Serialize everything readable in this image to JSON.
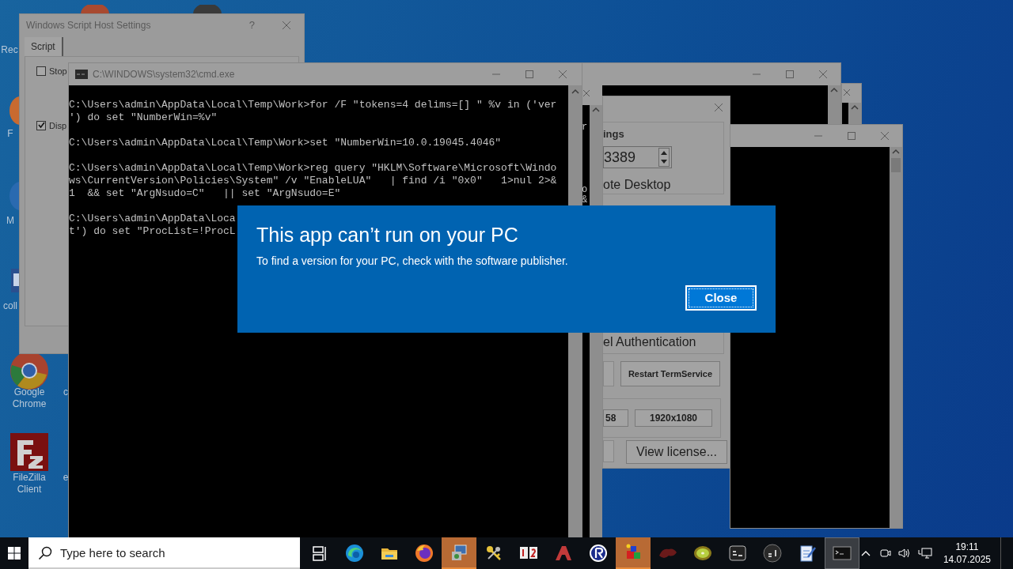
{
  "desktop_icons": [
    {
      "label": "Rec"
    },
    {
      "label": "F"
    },
    {
      "label": "M"
    },
    {
      "label": "coll"
    },
    {
      "label": "Google Chrome"
    },
    {
      "label": "FileZilla Client"
    },
    {
      "label": "c"
    },
    {
      "label": "e"
    }
  ],
  "wsh_window": {
    "title": "Windows Script Host Settings",
    "help": "?",
    "tabs": [
      {
        "label": "Script",
        "selected": true
      }
    ],
    "options": [
      {
        "label": "Stop",
        "checked": false
      },
      {
        "label": "Disp",
        "checked": true
      }
    ]
  },
  "cmd_window": {
    "title": "C:\\WINDOWS\\system32\\cmd.exe",
    "blocks": [
      [
        "C:\\Users\\admin\\AppData\\Local\\Temp\\Work>for /F \"tokens=4 delims=[] \" %v in ('ver",
        "') do set \"NumberWin=%v\""
      ],
      [
        "C:\\Users\\admin\\AppData\\Local\\Temp\\Work>set \"NumberWin=10.0.19045.4046\""
      ],
      [
        "C:\\Users\\admin\\AppData\\Local\\Temp\\Work>reg query \"HKLM\\Software\\Microsoft\\Windo",
        "ws\\CurrentVersion\\Policies\\System\" /v \"EnableLUA\"   | find /i \"0x0\"   1>nul 2>&",
        "1  && set \"ArgNsudo=C\"   || set \"ArgNsudo=E\""
      ],
      [
        "C:\\Users\\admin\\AppData\\Loca",
        "t') do set \"ProcList=!ProcL"
      ]
    ]
  },
  "console_fragment": {
    "chars": [
      "r",
      "o",
      "&"
    ]
  },
  "rdp_window": {
    "group_title": "ings",
    "port": "3389",
    "options": [
      "ote Desktop",
      "el Authentication"
    ],
    "buttons": [
      "Restart TermService",
      "58",
      "1920x1080",
      "View license..."
    ]
  },
  "dialog": {
    "title": "This app can’t run on your PC",
    "message": "To find a version for your PC, check with the software publisher.",
    "button": "Close"
  },
  "taskbar": {
    "search_placeholder": "Type here to search",
    "apps": [
      {
        "highlighted": false,
        "selected": false
      },
      {
        "highlighted": false,
        "selected": false
      },
      {
        "highlighted": false,
        "selected": false
      },
      {
        "highlighted": false,
        "selected": false
      },
      {
        "highlighted": true,
        "selected": false
      },
      {
        "highlighted": false,
        "selected": false
      },
      {
        "highlighted": false,
        "selected": false
      },
      {
        "highlighted": false,
        "selected": false
      },
      {
        "highlighted": false,
        "selected": false
      },
      {
        "highlighted": true,
        "selected": false
      },
      {
        "highlighted": false,
        "selected": false
      },
      {
        "highlighted": false,
        "selected": false
      },
      {
        "highlighted": false,
        "selected": false
      },
      {
        "highlighted": false,
        "selected": false
      },
      {
        "highlighted": false,
        "selected": false
      },
      {
        "highlighted": false,
        "selected": true
      }
    ],
    "time": "19:11",
    "date": "14.07.2025"
  }
}
